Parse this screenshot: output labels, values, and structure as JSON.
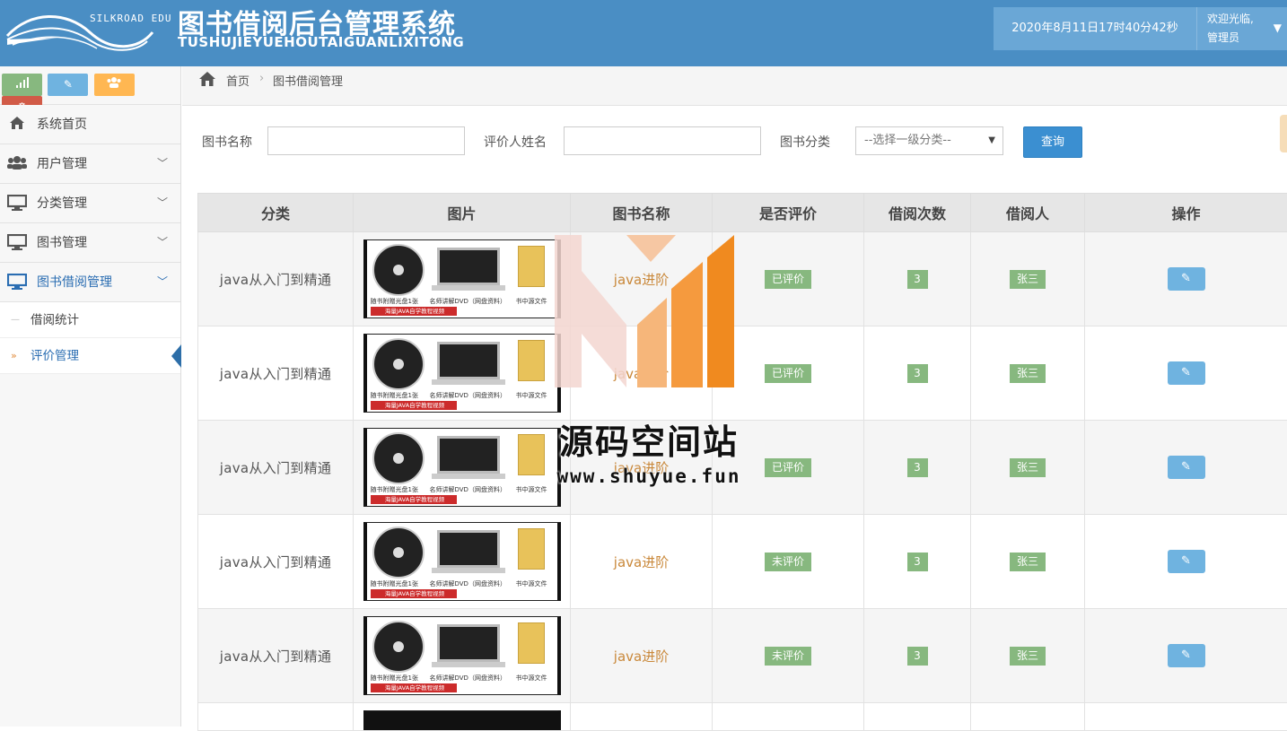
{
  "header": {
    "logo_text": "SILKROAD EDU",
    "title": "图书借阅后台管理系统",
    "subtitle": "TUSHUJIEYUEHOUTAIGUANLIXITONG",
    "datetime": "2020年8月11日17时40分42秒",
    "welcome_line1": "欢迎光临,",
    "welcome_line2": "管理员"
  },
  "sidebar": {
    "shortcut_colors": [
      "#87b87f",
      "#6fb3e0",
      "#ffb752",
      "#d15b47"
    ],
    "items": [
      {
        "label": "系统首页",
        "icon": "home-icon"
      },
      {
        "label": "用户管理",
        "icon": "users-icon"
      },
      {
        "label": "分类管理",
        "icon": "desktop-icon"
      },
      {
        "label": "图书管理",
        "icon": "desktop-icon"
      },
      {
        "label": "图书借阅管理",
        "icon": "desktop-icon"
      }
    ],
    "subitems": [
      {
        "label": "借阅统计"
      },
      {
        "label": "评价管理"
      }
    ]
  },
  "breadcrumb": {
    "home": "首页",
    "current": "图书借阅管理"
  },
  "search": {
    "book_name_label": "图书名称",
    "book_name_value": "",
    "reviewer_label": "评价人姓名",
    "reviewer_value": "",
    "category_label": "图书分类",
    "category_selected": "--选择一级分类--",
    "query_button": "查询"
  },
  "table": {
    "headers": [
      "分类",
      "图片",
      "图书名称",
      "是否评价",
      "借阅次数",
      "借阅人",
      "操作"
    ],
    "rows": [
      {
        "category": "java从入门到精通",
        "book_name": "java进阶",
        "reviewed": "已评价",
        "count": "3",
        "borrower": "张三"
      },
      {
        "category": "java从入门到精通",
        "book_name": "java进阶",
        "reviewed": "已评价",
        "count": "3",
        "borrower": "张三"
      },
      {
        "category": "java从入门到精通",
        "book_name": "java进阶",
        "reviewed": "已评价",
        "count": "3",
        "borrower": "张三"
      },
      {
        "category": "java从入门到精通",
        "book_name": "java进阶",
        "reviewed": "未评价",
        "count": "3",
        "borrower": "张三"
      },
      {
        "category": "java从入门到精通",
        "book_name": "java进阶",
        "reviewed": "未评价",
        "count": "3",
        "borrower": "张三"
      }
    ],
    "thumb": {
      "cap1": "随书附赠光盘1张",
      "cap2": "名师讲解DVD（网盘资料）",
      "cap3": "书中源文件",
      "banner": "海量JAVA自学教程视频"
    },
    "edit_icon": "edit-icon",
    "colors": {
      "badge": "#87b87f",
      "edit": "#6fb3e0",
      "book_name": "#c9883a"
    }
  },
  "watermark": {
    "text": "源码空间站",
    "url": "www.shuyue.fun"
  }
}
